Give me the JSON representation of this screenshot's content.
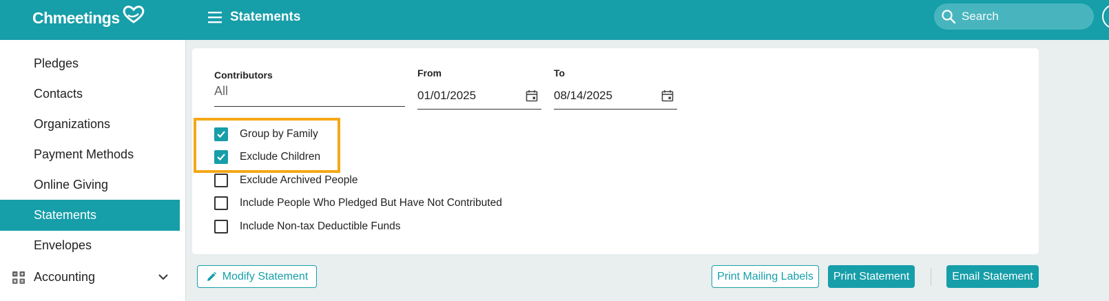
{
  "header": {
    "logo_text": "Chmeetings",
    "page_title": "Statements",
    "search_placeholder": "Search",
    "color": "#169ea9"
  },
  "sidebar": {
    "items": [
      {
        "label": "Pledges",
        "active": false
      },
      {
        "label": "Contacts",
        "active": false
      },
      {
        "label": "Organizations",
        "active": false
      },
      {
        "label": "Payment Methods",
        "active": false
      },
      {
        "label": "Online Giving",
        "active": false
      },
      {
        "label": "Statements",
        "active": true
      },
      {
        "label": "Envelopes",
        "active": false
      }
    ],
    "accounting_label": "Accounting"
  },
  "form": {
    "contributors": {
      "label": "Contributors",
      "value": "All"
    },
    "from": {
      "label": "From",
      "value": "01/01/2025"
    },
    "to": {
      "label": "To",
      "value": "08/14/2025"
    },
    "options": [
      {
        "label": "Group by Family",
        "checked": true
      },
      {
        "label": "Exclude Children",
        "checked": true
      },
      {
        "label": "Exclude Archived People",
        "checked": false
      },
      {
        "label": "Include People Who Pledged But Have Not Contributed",
        "checked": false
      },
      {
        "label": "Include Non-tax Deductible Funds",
        "checked": false
      }
    ]
  },
  "actions": {
    "modify": "Modify Statement",
    "print_labels": "Print Mailing Labels",
    "print_statement": "Print Statement",
    "email_statement": "Email Statement"
  }
}
